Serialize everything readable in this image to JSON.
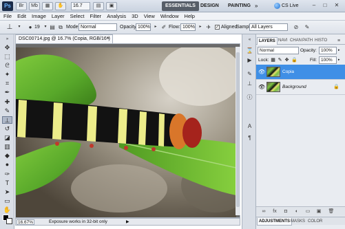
{
  "titlebar": {
    "logo": "Ps",
    "icon_br": "Br",
    "icon_mb": "Mb",
    "zoom": "16.7",
    "workspaces": [
      "ESSENTIALS",
      "DESIGN",
      "PAINTING"
    ],
    "more": "»",
    "cs_live": "CS Live",
    "win_min": "–",
    "win_max": "□",
    "win_close": "✕"
  },
  "menu": [
    "File",
    "Edit",
    "Image",
    "Layer",
    "Select",
    "Filter",
    "Analysis",
    "3D",
    "View",
    "Window",
    "Help"
  ],
  "options": {
    "brush_size": "19",
    "mode_label": "Mode:",
    "mode_value": "Normal",
    "opacity_label": "Opacity:",
    "opacity_value": "100%",
    "flow_label": "Flow:",
    "flow_value": "100%",
    "aligned_label": "Aligned",
    "aligned_check": "✓",
    "sample_label": "Sample:",
    "sample_value": "All Layers"
  },
  "document": {
    "tab_title": "DSC00714.jpg @ 16.7% (Copia, RGB/16*) *",
    "tab_close": "×",
    "status_zoom": "16.67%",
    "status_text": "Exposure works in 32-bit only",
    "status_arrow": "▶"
  },
  "layers_panel": {
    "tabs": [
      "LAYERS",
      "NAVI",
      "CHAN",
      "PATH",
      "HISTO"
    ],
    "blend_mode": "Normal",
    "opacity_label": "Opacity:",
    "opacity_value": "100%",
    "lock_label": "Lock:",
    "fill_label": "Fill:",
    "fill_value": "100%",
    "layers": [
      {
        "name": "Copia",
        "selected": true,
        "locked": false
      },
      {
        "name": "Background",
        "selected": false,
        "locked": true
      }
    ],
    "bottom_tabs": [
      "ADJUSTMENTS",
      "MASKS",
      "COLOR"
    ]
  },
  "colors": {
    "selected_layer": "#3f8fe6",
    "workspace_active": "#565d68"
  }
}
